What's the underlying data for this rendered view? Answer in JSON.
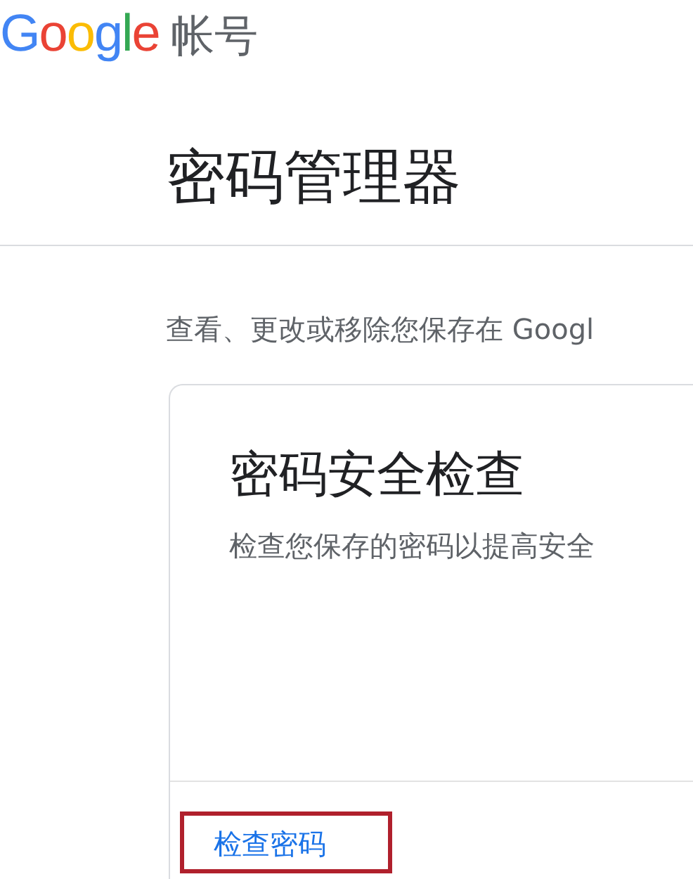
{
  "header": {
    "logo": {
      "text": "Google"
    },
    "product": "帐号"
  },
  "page_title": "密码管理器",
  "description": "查看、更改或移除您保存在 Googl",
  "card": {
    "title": "密码安全检查",
    "subtitle": "检查您保存的密码以提高安全",
    "action": {
      "label": "检查密码",
      "highlighted": true
    }
  }
}
